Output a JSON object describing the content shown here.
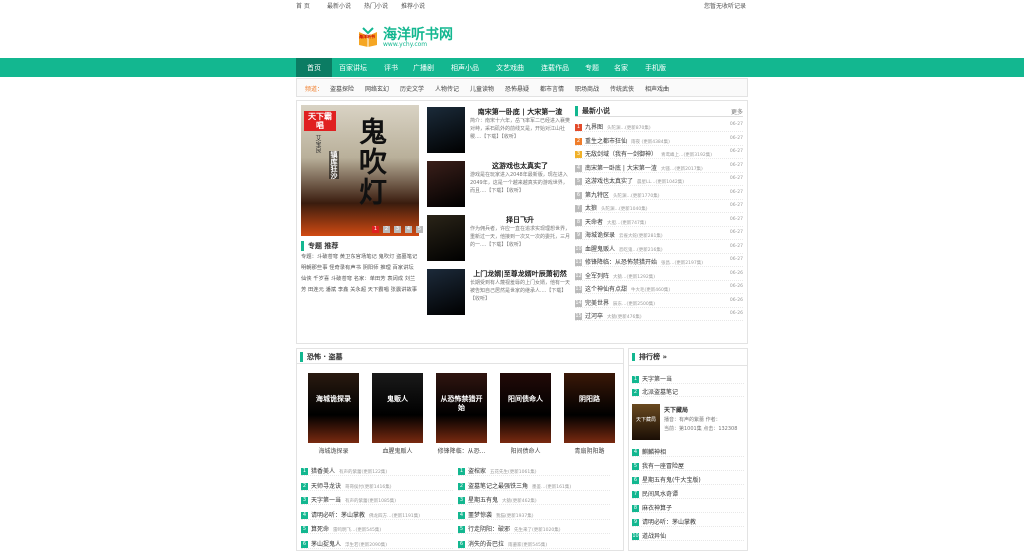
{
  "topbar": {
    "home": "首 页",
    "l1": "最新小说",
    "l2": "热门小说",
    "l3": "推荐小说",
    "right": "您暂无收听记录"
  },
  "logo": {
    "name": "海洋听书网",
    "url": "www.ychy.com",
    "badge": "海洋听书"
  },
  "nav": [
    "首页",
    "百家讲坛",
    "评书",
    "广播剧",
    "相声小品",
    "文艺戏曲",
    "连载作品",
    "专题",
    "名家",
    "手机版"
  ],
  "subnav": {
    "label": "频道：",
    "items": [
      "盗墓探险",
      "网络玄幻",
      "历史文学",
      "人物传记",
      "儿童读物",
      "恐怖悬疑",
      "都市言情",
      "职场商战",
      "传统武侠",
      "相声戏曲"
    ]
  },
  "featured": {
    "title": "鬼吹灯",
    "author": "天下霸唱",
    "cover_sub": "镇库狂沙",
    "narrator": "艾宝良",
    "pages": [
      "1",
      "2",
      "3",
      "4",
      "5"
    ]
  },
  "topics": {
    "heading": "专题 推荐",
    "text": "专题：斗破苍穹 黄卫东官场笔记 鬼吹灯 盗墓笔记 明朝那些事 怪奇录有声书 阴阳师 推理 百家讲坛 仙侠 千岁喜 斗破苍穹 名家：单田芳 袁阔成 刘兰芳 田连元 潘斌 李鑫 关永超 天下霸唱 张震讲故事"
  },
  "mid_books": [
    {
      "title": "南宋第一卧底 | 大宋第一渣",
      "desc": "简介：南宋十六年，岳飞率军二已经进入襄樊对峙，采石矶外的前线又是，开始对江山社稷....【下载】【收听】"
    },
    {
      "title": "这游戏也太真实了",
      "desc": "游戏是在玩家进入2048年最新版，现在进入2049年，这是一个越来越真实的游戏世界，而且....【下载】【收听】"
    },
    {
      "title": "择日飞升",
      "desc": "作为佣兵者，许应一直在追求实现理想世界，重新过一天，他接到一次又一次的委托，三月的一....【下载】【收听】"
    },
    {
      "title": "上门龙婿|至尊龙婿叶辰萧初然",
      "desc": "长期受到有人蔑视羞辱的上门女婿，他有一天被告知自己居然是世家的继承人....【下载】【收听】"
    }
  ],
  "latest": {
    "title": "最新小说",
    "more": "更多",
    "items": [
      {
        "n": "1",
        "title": "九界图",
        "extra": "头陀渊…(更新870集)",
        "date": "06-27"
      },
      {
        "n": "2",
        "title": "重生之都市狂仙",
        "extra": "雨夜 (更新4384集)",
        "date": "06-27"
      },
      {
        "n": "3",
        "title": "无敌剑域（我有一剑御神）",
        "extra": "青鸾峰上…(更新3192集)",
        "date": "06-27"
      },
      {
        "n": "4",
        "title": "南宋第一卧底 | 大宋第一渣",
        "extra": "大骚…(更新2017集)",
        "date": "06-27"
      },
      {
        "n": "5",
        "title": "这游戏也太真实了",
        "extra": "晨星LL…(更新1042集)",
        "date": "06-27"
      },
      {
        "n": "6",
        "title": "第九特区",
        "extra": "头陀渊…(更新1770集)",
        "date": "06-27"
      },
      {
        "n": "7",
        "title": "太狼",
        "extra": "头陀渊…(更新1040集)",
        "date": "06-27"
      },
      {
        "n": "8",
        "title": "天命者",
        "extra": "大胆…(更新747集)",
        "date": "06-27"
      },
      {
        "n": "9",
        "title": "海城诡探录",
        "extra": "云雀大蛇(更新281集)",
        "date": "06-27"
      },
      {
        "n": "10",
        "title": "血腥鬼贩人",
        "extra": "恐吃鬼…(更新216集)",
        "date": "06-27"
      },
      {
        "n": "11",
        "title": "修锋降临：从恐怖禁猎开始",
        "extra": "张昌…(更新2197集)",
        "date": "06-27"
      },
      {
        "n": "12",
        "title": "全军列阵",
        "extra": "大猿…(更新1292集)",
        "date": "06-26"
      },
      {
        "n": "13",
        "title": "这个神仙有点甜",
        "extra": "牛大毛(更新460集)",
        "date": "06-26"
      },
      {
        "n": "14",
        "title": "完美世界",
        "extra": "辰东…(更新2500集)",
        "date": "06-26"
      },
      {
        "n": "15",
        "title": "过河卒",
        "extra": "大猿(更新476集)",
        "date": "06-26"
      }
    ]
  },
  "horror": {
    "title": "恐怖 · 盗墓",
    "covers": [
      {
        "name": "海城诡探录",
        "art": "海城诡探录"
      },
      {
        "name": "血腥鬼贩人",
        "art": "鬼贩人"
      },
      {
        "name": "修锋降临：从恐...",
        "art": "从恐怖禁猎开始"
      },
      {
        "name": "阳间债命人",
        "art": "阳间债命人"
      },
      {
        "name": "青扇阴阳路",
        "art": "阴阳路"
      }
    ],
    "left": [
      {
        "n": "1",
        "t": "猎香美人",
        "e": "有声的紫蕾(更新122集)"
      },
      {
        "n": "2",
        "t": "天师寻龙诀",
        "e": "哥哥侯付(更新1416集)"
      },
      {
        "n": "3",
        "t": "天字第一当",
        "e": "有声的紫蕾(更新1085集)"
      },
      {
        "n": "4",
        "t": "请明必听：茅山掌教",
        "e": "佛龙四方…(更新1191集)"
      },
      {
        "n": "5",
        "t": "算死命",
        "e": "雷鸣明飞…(更新545集)"
      },
      {
        "n": "6",
        "t": "茅山捉鬼人",
        "e": "浮生若(更新2090集)"
      }
    ],
    "right": [
      {
        "n": "1",
        "t": "盗棺家",
        "e": "五花先生(更新1061集)"
      },
      {
        "n": "2",
        "t": "盗墓笔记之最强铁三角",
        "e": "墨鉴…(更新161集)"
      },
      {
        "n": "3",
        "t": "星期五有鬼",
        "e": "大猿(更新462集)"
      },
      {
        "n": "4",
        "t": "噩梦惊袭",
        "e": "我猫(更新1937集)"
      },
      {
        "n": "5",
        "t": "行走阴阳：破邪",
        "e": "先生来了(更新1020集)"
      },
      {
        "n": "6",
        "t": "消失的吾巴拉",
        "e": "雨鎏家(更新545集)"
      }
    ]
  },
  "rank": {
    "title": "排行榜",
    "arrow": "»",
    "top": [
      {
        "n": "1",
        "t": "天字第一当"
      },
      {
        "n": "2",
        "t": "北派盗墓笔记"
      }
    ],
    "featured": {
      "n": "3",
      "t": "天下藏局",
      "l1": "播音：有声的紫蕾 作者：",
      "l2": "当前：第1001集 点击：132308",
      "cover": "天下藏局"
    },
    "rest": [
      {
        "n": "4",
        "t": "麒麟神相"
      },
      {
        "n": "5",
        "t": "我有一座冒险屋"
      },
      {
        "n": "6",
        "t": "星期五有鬼(牛大宝版)"
      },
      {
        "n": "7",
        "t": "民间风水奇谭"
      },
      {
        "n": "8",
        "t": "麻衣神算子"
      },
      {
        "n": "9",
        "t": "请明必听：茅山掌教"
      },
      {
        "n": "10",
        "t": "道战异仙"
      }
    ]
  }
}
